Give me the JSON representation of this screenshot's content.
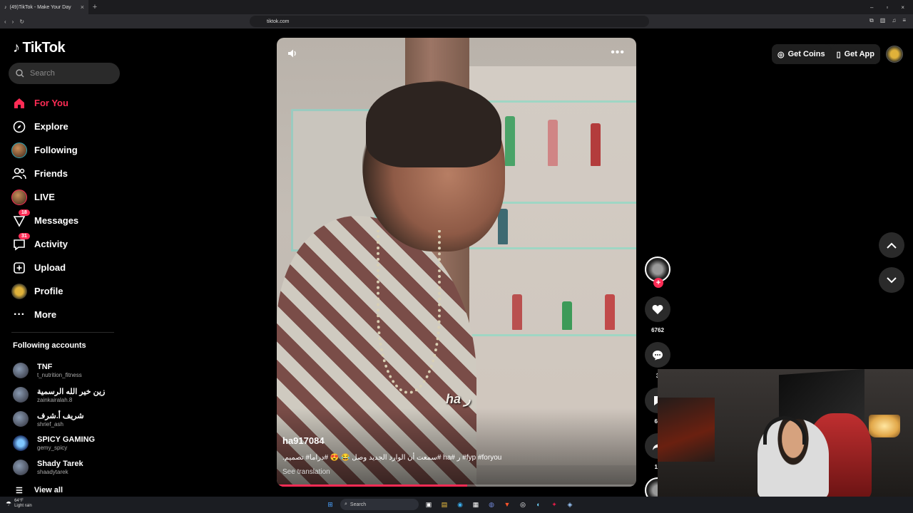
{
  "browser": {
    "tab_title": "(49)TikTok - Make Your Day",
    "tab_close": "×",
    "new_tab": "+",
    "url": "tiktok.com",
    "window_controls": [
      "–",
      "▫",
      "×"
    ]
  },
  "sidebar": {
    "logo_text": "TikTok",
    "search_placeholder": "Search",
    "nav": [
      {
        "label": "For You",
        "icon": "home-icon"
      },
      {
        "label": "Explore",
        "icon": "compass-icon"
      },
      {
        "label": "Following",
        "icon": "avatar"
      },
      {
        "label": "Friends",
        "icon": "friends-icon"
      },
      {
        "label": "LIVE",
        "icon": "avatar"
      },
      {
        "label": "Messages",
        "icon": "messages-icon",
        "badge": "18"
      },
      {
        "label": "Activity",
        "icon": "activity-icon",
        "badge": "31"
      },
      {
        "label": "Upload",
        "icon": "upload-icon"
      },
      {
        "label": "Profile",
        "icon": "avatar"
      },
      {
        "label": "More",
        "icon": "more-icon"
      }
    ],
    "following_title": "Following accounts",
    "following": [
      {
        "name": "TNF",
        "handle": "t_nutrition_fitness"
      },
      {
        "name": "زين خير الله الرسمية",
        "handle": "zainkairalah.8"
      },
      {
        "name": "شريف أ.شرف",
        "handle": "shrief_ash"
      },
      {
        "name": "SPICY GAMING",
        "handle": "gemy_spicy"
      },
      {
        "name": "Shady Tarek",
        "handle": "shaadytarek"
      }
    ],
    "view_all": "View all"
  },
  "video": {
    "overlay_text": "ha ر",
    "author": "ha917084",
    "caption": ".سمعت أن الوارد الجديد وصل 😂 😍 #دراما# تصميم# ha# ر #fyp #foryou",
    "see_translation": "See translation",
    "progress": 0.53
  },
  "actions": {
    "likes": "6762",
    "comments": "3",
    "saves": "60",
    "shares": "18",
    "follow": "+"
  },
  "header": {
    "get_coins": "Get Coins",
    "get_app": "Get App"
  },
  "nav_arrows": {
    "up": "⌃",
    "down": "⌄"
  },
  "taskbar": {
    "weather_temp": "64°F",
    "weather_desc": "Light rain",
    "search": "Search"
  },
  "colors": {
    "accent": "#fe2c55",
    "background": "#000000"
  }
}
